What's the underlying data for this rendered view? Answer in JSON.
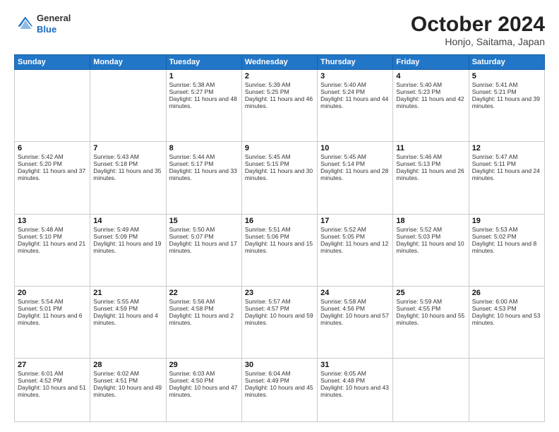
{
  "header": {
    "logo": {
      "general": "General",
      "blue": "Blue"
    },
    "title": "October 2024",
    "subtitle": "Honjo, Saitama, Japan"
  },
  "columns": [
    "Sunday",
    "Monday",
    "Tuesday",
    "Wednesday",
    "Thursday",
    "Friday",
    "Saturday"
  ],
  "weeks": [
    {
      "days": [
        {
          "num": "",
          "sunrise": "",
          "sunset": "",
          "daylight": "",
          "empty": true
        },
        {
          "num": "",
          "sunrise": "",
          "sunset": "",
          "daylight": "",
          "empty": true
        },
        {
          "num": "1",
          "sunrise": "Sunrise: 5:38 AM",
          "sunset": "Sunset: 5:27 PM",
          "daylight": "Daylight: 11 hours and 48 minutes."
        },
        {
          "num": "2",
          "sunrise": "Sunrise: 5:39 AM",
          "sunset": "Sunset: 5:25 PM",
          "daylight": "Daylight: 11 hours and 46 minutes."
        },
        {
          "num": "3",
          "sunrise": "Sunrise: 5:40 AM",
          "sunset": "Sunset: 5:24 PM",
          "daylight": "Daylight: 11 hours and 44 minutes."
        },
        {
          "num": "4",
          "sunrise": "Sunrise: 5:40 AM",
          "sunset": "Sunset: 5:23 PM",
          "daylight": "Daylight: 11 hours and 42 minutes."
        },
        {
          "num": "5",
          "sunrise": "Sunrise: 5:41 AM",
          "sunset": "Sunset: 5:21 PM",
          "daylight": "Daylight: 11 hours and 39 minutes."
        }
      ]
    },
    {
      "days": [
        {
          "num": "6",
          "sunrise": "Sunrise: 5:42 AM",
          "sunset": "Sunset: 5:20 PM",
          "daylight": "Daylight: 11 hours and 37 minutes."
        },
        {
          "num": "7",
          "sunrise": "Sunrise: 5:43 AM",
          "sunset": "Sunset: 5:18 PM",
          "daylight": "Daylight: 11 hours and 35 minutes."
        },
        {
          "num": "8",
          "sunrise": "Sunrise: 5:44 AM",
          "sunset": "Sunset: 5:17 PM",
          "daylight": "Daylight: 11 hours and 33 minutes."
        },
        {
          "num": "9",
          "sunrise": "Sunrise: 5:45 AM",
          "sunset": "Sunset: 5:15 PM",
          "daylight": "Daylight: 11 hours and 30 minutes."
        },
        {
          "num": "10",
          "sunrise": "Sunrise: 5:45 AM",
          "sunset": "Sunset: 5:14 PM",
          "daylight": "Daylight: 11 hours and 28 minutes."
        },
        {
          "num": "11",
          "sunrise": "Sunrise: 5:46 AM",
          "sunset": "Sunset: 5:13 PM",
          "daylight": "Daylight: 11 hours and 26 minutes."
        },
        {
          "num": "12",
          "sunrise": "Sunrise: 5:47 AM",
          "sunset": "Sunset: 5:11 PM",
          "daylight": "Daylight: 11 hours and 24 minutes."
        }
      ]
    },
    {
      "days": [
        {
          "num": "13",
          "sunrise": "Sunrise: 5:48 AM",
          "sunset": "Sunset: 5:10 PM",
          "daylight": "Daylight: 11 hours and 21 minutes."
        },
        {
          "num": "14",
          "sunrise": "Sunrise: 5:49 AM",
          "sunset": "Sunset: 5:09 PM",
          "daylight": "Daylight: 11 hours and 19 minutes."
        },
        {
          "num": "15",
          "sunrise": "Sunrise: 5:50 AM",
          "sunset": "Sunset: 5:07 PM",
          "daylight": "Daylight: 11 hours and 17 minutes."
        },
        {
          "num": "16",
          "sunrise": "Sunrise: 5:51 AM",
          "sunset": "Sunset: 5:06 PM",
          "daylight": "Daylight: 11 hours and 15 minutes."
        },
        {
          "num": "17",
          "sunrise": "Sunrise: 5:52 AM",
          "sunset": "Sunset: 5:05 PM",
          "daylight": "Daylight: 11 hours and 12 minutes."
        },
        {
          "num": "18",
          "sunrise": "Sunrise: 5:52 AM",
          "sunset": "Sunset: 5:03 PM",
          "daylight": "Daylight: 11 hours and 10 minutes."
        },
        {
          "num": "19",
          "sunrise": "Sunrise: 5:53 AM",
          "sunset": "Sunset: 5:02 PM",
          "daylight": "Daylight: 11 hours and 8 minutes."
        }
      ]
    },
    {
      "days": [
        {
          "num": "20",
          "sunrise": "Sunrise: 5:54 AM",
          "sunset": "Sunset: 5:01 PM",
          "daylight": "Daylight: 11 hours and 6 minutes."
        },
        {
          "num": "21",
          "sunrise": "Sunrise: 5:55 AM",
          "sunset": "Sunset: 4:59 PM",
          "daylight": "Daylight: 11 hours and 4 minutes."
        },
        {
          "num": "22",
          "sunrise": "Sunrise: 5:56 AM",
          "sunset": "Sunset: 4:58 PM",
          "daylight": "Daylight: 11 hours and 2 minutes."
        },
        {
          "num": "23",
          "sunrise": "Sunrise: 5:57 AM",
          "sunset": "Sunset: 4:57 PM",
          "daylight": "Daylight: 10 hours and 59 minutes."
        },
        {
          "num": "24",
          "sunrise": "Sunrise: 5:58 AM",
          "sunset": "Sunset: 4:56 PM",
          "daylight": "Daylight: 10 hours and 57 minutes."
        },
        {
          "num": "25",
          "sunrise": "Sunrise: 5:59 AM",
          "sunset": "Sunset: 4:55 PM",
          "daylight": "Daylight: 10 hours and 55 minutes."
        },
        {
          "num": "26",
          "sunrise": "Sunrise: 6:00 AM",
          "sunset": "Sunset: 4:53 PM",
          "daylight": "Daylight: 10 hours and 53 minutes."
        }
      ]
    },
    {
      "days": [
        {
          "num": "27",
          "sunrise": "Sunrise: 6:01 AM",
          "sunset": "Sunset: 4:52 PM",
          "daylight": "Daylight: 10 hours and 51 minutes."
        },
        {
          "num": "28",
          "sunrise": "Sunrise: 6:02 AM",
          "sunset": "Sunset: 4:51 PM",
          "daylight": "Daylight: 10 hours and 49 minutes."
        },
        {
          "num": "29",
          "sunrise": "Sunrise: 6:03 AM",
          "sunset": "Sunset: 4:50 PM",
          "daylight": "Daylight: 10 hours and 47 minutes."
        },
        {
          "num": "30",
          "sunrise": "Sunrise: 6:04 AM",
          "sunset": "Sunset: 4:49 PM",
          "daylight": "Daylight: 10 hours and 45 minutes."
        },
        {
          "num": "31",
          "sunrise": "Sunrise: 6:05 AM",
          "sunset": "Sunset: 4:48 PM",
          "daylight": "Daylight: 10 hours and 43 minutes."
        },
        {
          "num": "",
          "sunrise": "",
          "sunset": "",
          "daylight": "",
          "empty": true
        },
        {
          "num": "",
          "sunrise": "",
          "sunset": "",
          "daylight": "",
          "empty": true
        }
      ]
    }
  ]
}
